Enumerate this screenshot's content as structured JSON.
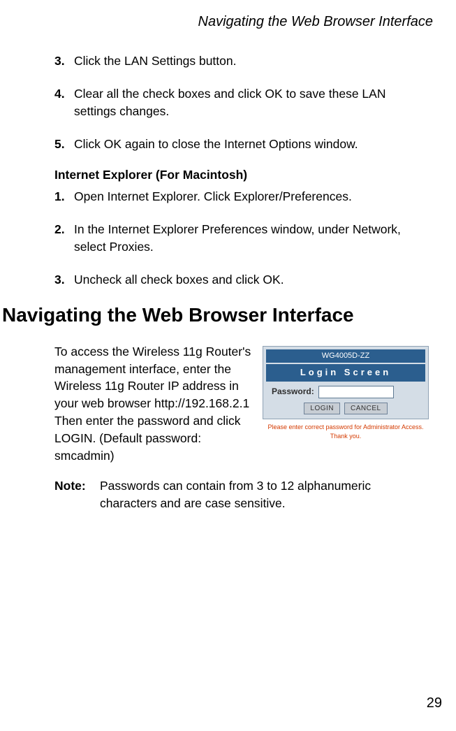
{
  "headerTitle": "Navigating the Web Browser Interface",
  "sectionA": {
    "steps": [
      {
        "num": "3.",
        "text": "Click the LAN Settings button."
      },
      {
        "num": "4.",
        "text": "Clear all the check boxes and click OK to save these LAN settings changes."
      },
      {
        "num": "5.",
        "text": "Click OK again to close the Internet Options window."
      }
    ]
  },
  "subheading": "Internet Explorer (For Macintosh)",
  "sectionB": {
    "steps": [
      {
        "num": "1.",
        "text": "Open Internet Explorer. Click Explorer/Preferences."
      },
      {
        "num": "2.",
        "text": "In the Internet Explorer Preferences window, under Network, select Proxies."
      },
      {
        "num": "3.",
        "text": "Uncheck all check boxes and click OK."
      }
    ]
  },
  "sectionHeading": "Navigating the Web Browser Interface",
  "paragraph": "To access the Wireless 11g Router's management interface, enter the Wireless 11g Router IP address in your web browser http://192.168.2.1 Then enter the password and click LOGIN. (Default password: smcadmin)",
  "note": {
    "label": "Note:",
    "text": "Passwords can contain from 3 to 12 alphanumeric characters and are case sensitive."
  },
  "loginScreenshot": {
    "titleBar": "WG4005D-ZZ",
    "screenLabel": "Login Screen",
    "passwordLabel": "Password:",
    "passwordValue": "",
    "loginBtn": "LOGIN",
    "cancelBtn": "CANCEL",
    "footer": "Please enter correct password for Administrator Access. Thank you."
  },
  "pageNumber": "29"
}
